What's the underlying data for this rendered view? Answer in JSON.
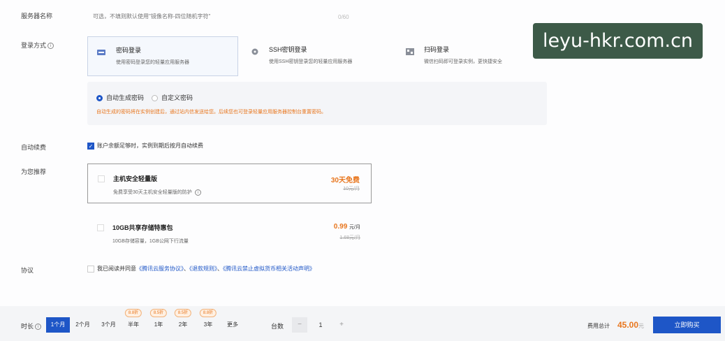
{
  "server_name": {
    "label": "服务器名称",
    "placeholder": "可选，不填则默认使用\"镜像名称-四位随机字符\"",
    "counter": "0/60"
  },
  "login": {
    "label": "登录方式",
    "options": [
      {
        "title": "密码登录",
        "desc": "使用密码登录您的轻量应用服务器"
      },
      {
        "title": "SSH密钥登录",
        "desc": "使用SSH密钥登录您的轻量应用服务器"
      },
      {
        "title": "扫码登录",
        "desc": "微信扫码即可登录实例，更快捷安全"
      }
    ],
    "password_modes": [
      "自动生成密码",
      "自定义密码"
    ],
    "note": "自动生成的密码将在实例创建后，通过站内信发送给您。后续您也可登录轻量应用服务器控制台重置密码。"
  },
  "auto_renew": {
    "label": "自动续费",
    "text": "账户余额足够时，实例到期后按月自动续费"
  },
  "recommend": {
    "label": "为您推荐",
    "items": [
      {
        "title": "主机安全轻量版",
        "desc": "免费享受30天主机安全轻量版的防护",
        "price": "30天免费",
        "unit": "",
        "old_price": "10元/月"
      },
      {
        "title": "10GB共享存储特惠包",
        "desc": "10GB存储容量，1GB公网下行流量",
        "price": "0.99",
        "unit": "元/月",
        "old_price": "1.68元/月"
      }
    ]
  },
  "agreement": {
    "label": "协议",
    "prefix": "我已阅读并同意",
    "link1": "《腾讯云服务协议》",
    "sep1": "、",
    "link2": "《退款规则》",
    "sep2": "、",
    "link3": "《腾讯云禁止虚拟货币相关活动声明》"
  },
  "footer": {
    "duration_label": "时长",
    "durations": [
      {
        "label": "1个月",
        "discount": ""
      },
      {
        "label": "2个月",
        "discount": ""
      },
      {
        "label": "3个月",
        "discount": ""
      },
      {
        "label": "半年",
        "discount": "8.8折"
      },
      {
        "label": "1年",
        "discount": "8.5折"
      },
      {
        "label": "2年",
        "discount": "8.5折"
      },
      {
        "label": "3年",
        "discount": "8.8折"
      },
      {
        "label": "更多",
        "discount": ""
      }
    ],
    "quantity_label": "台数",
    "minus": "−",
    "quantity": "1",
    "plus": "+",
    "total_label": "费用总计",
    "total_price": "45.00",
    "currency": "元",
    "buy_label": "立即购买"
  },
  "watermark": "leyu-hkr.com.cn",
  "colors": {
    "accent": "#1e56c7",
    "price": "#e8761e"
  }
}
